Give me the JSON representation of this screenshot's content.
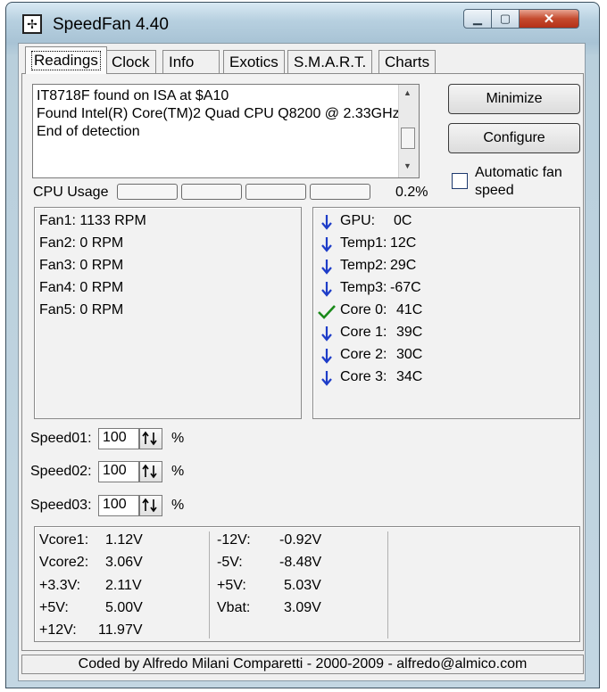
{
  "window": {
    "title": "SpeedFan 4.40",
    "controls": {
      "minimize": "▁",
      "maximize": "▢",
      "close": "✕"
    }
  },
  "tabs": [
    {
      "label": "Readings",
      "active": true
    },
    {
      "label": "Clock"
    },
    {
      "label": "Info"
    },
    {
      "label": "Exotics"
    },
    {
      "label": "S.M.A.R.T."
    },
    {
      "label": "Charts"
    }
  ],
  "log": {
    "lines": [
      "IT8718F found on ISA at $A10",
      "Found Intel(R) Core(TM)2 Quad CPU Q8200 @ 2.33GHz",
      "End of detection"
    ]
  },
  "buttons": {
    "minimize": "Minimize",
    "configure": "Configure"
  },
  "auto_fan": {
    "label_line1": "Automatic fan",
    "label_line2": "speed",
    "checked": false
  },
  "cpu": {
    "label": "CPU Usage",
    "percent": "0.2%",
    "cores": 4
  },
  "fans": [
    "Fan1: 1133 RPM",
    "Fan2: 0 RPM",
    "Fan3: 0 RPM",
    "Fan4: 0 RPM",
    "Fan5: 0 RPM"
  ],
  "temps": [
    {
      "label": "GPU:",
      "value": "0C",
      "status": "down"
    },
    {
      "label": "Temp1:",
      "value": "12C",
      "status": "down"
    },
    {
      "label": "Temp2:",
      "value": "29C",
      "status": "down"
    },
    {
      "label": "Temp3:",
      "value": "-67C",
      "status": "down"
    },
    {
      "label": "Core 0:",
      "value": "41C",
      "status": "ok"
    },
    {
      "label": "Core 1:",
      "value": "39C",
      "status": "down"
    },
    {
      "label": "Core 2:",
      "value": "30C",
      "status": "down"
    },
    {
      "label": "Core 3:",
      "value": "34C",
      "status": "down"
    }
  ],
  "speeds": [
    {
      "label": "Speed01:",
      "value": "100",
      "unit": "%"
    },
    {
      "label": "Speed02:",
      "value": "100",
      "unit": "%"
    },
    {
      "label": "Speed03:",
      "value": "100",
      "unit": "%"
    }
  ],
  "voltages_col1": [
    {
      "label": "Vcore1:",
      "value": "1.12V"
    },
    {
      "label": "Vcore2:",
      "value": "3.06V"
    },
    {
      "label": "+3.3V:",
      "value": "2.11V"
    },
    {
      "label": "+5V:",
      "value": "5.00V"
    },
    {
      "label": "+12V:",
      "value": "11.97V"
    }
  ],
  "voltages_col2": [
    {
      "label": "-12V:",
      "value": "-0.92V"
    },
    {
      "label": "-5V:",
      "value": "-8.48V"
    },
    {
      "label": "+5V:",
      "value": "5.03V"
    },
    {
      "label": "Vbat:",
      "value": "3.09V"
    }
  ],
  "footer": "Coded by Alfredo Milani Comparetti - 2000-2009 - alfredo@almico.com",
  "colors": {
    "arrow": "#1d3cc8",
    "check": "#1a8a1a"
  }
}
